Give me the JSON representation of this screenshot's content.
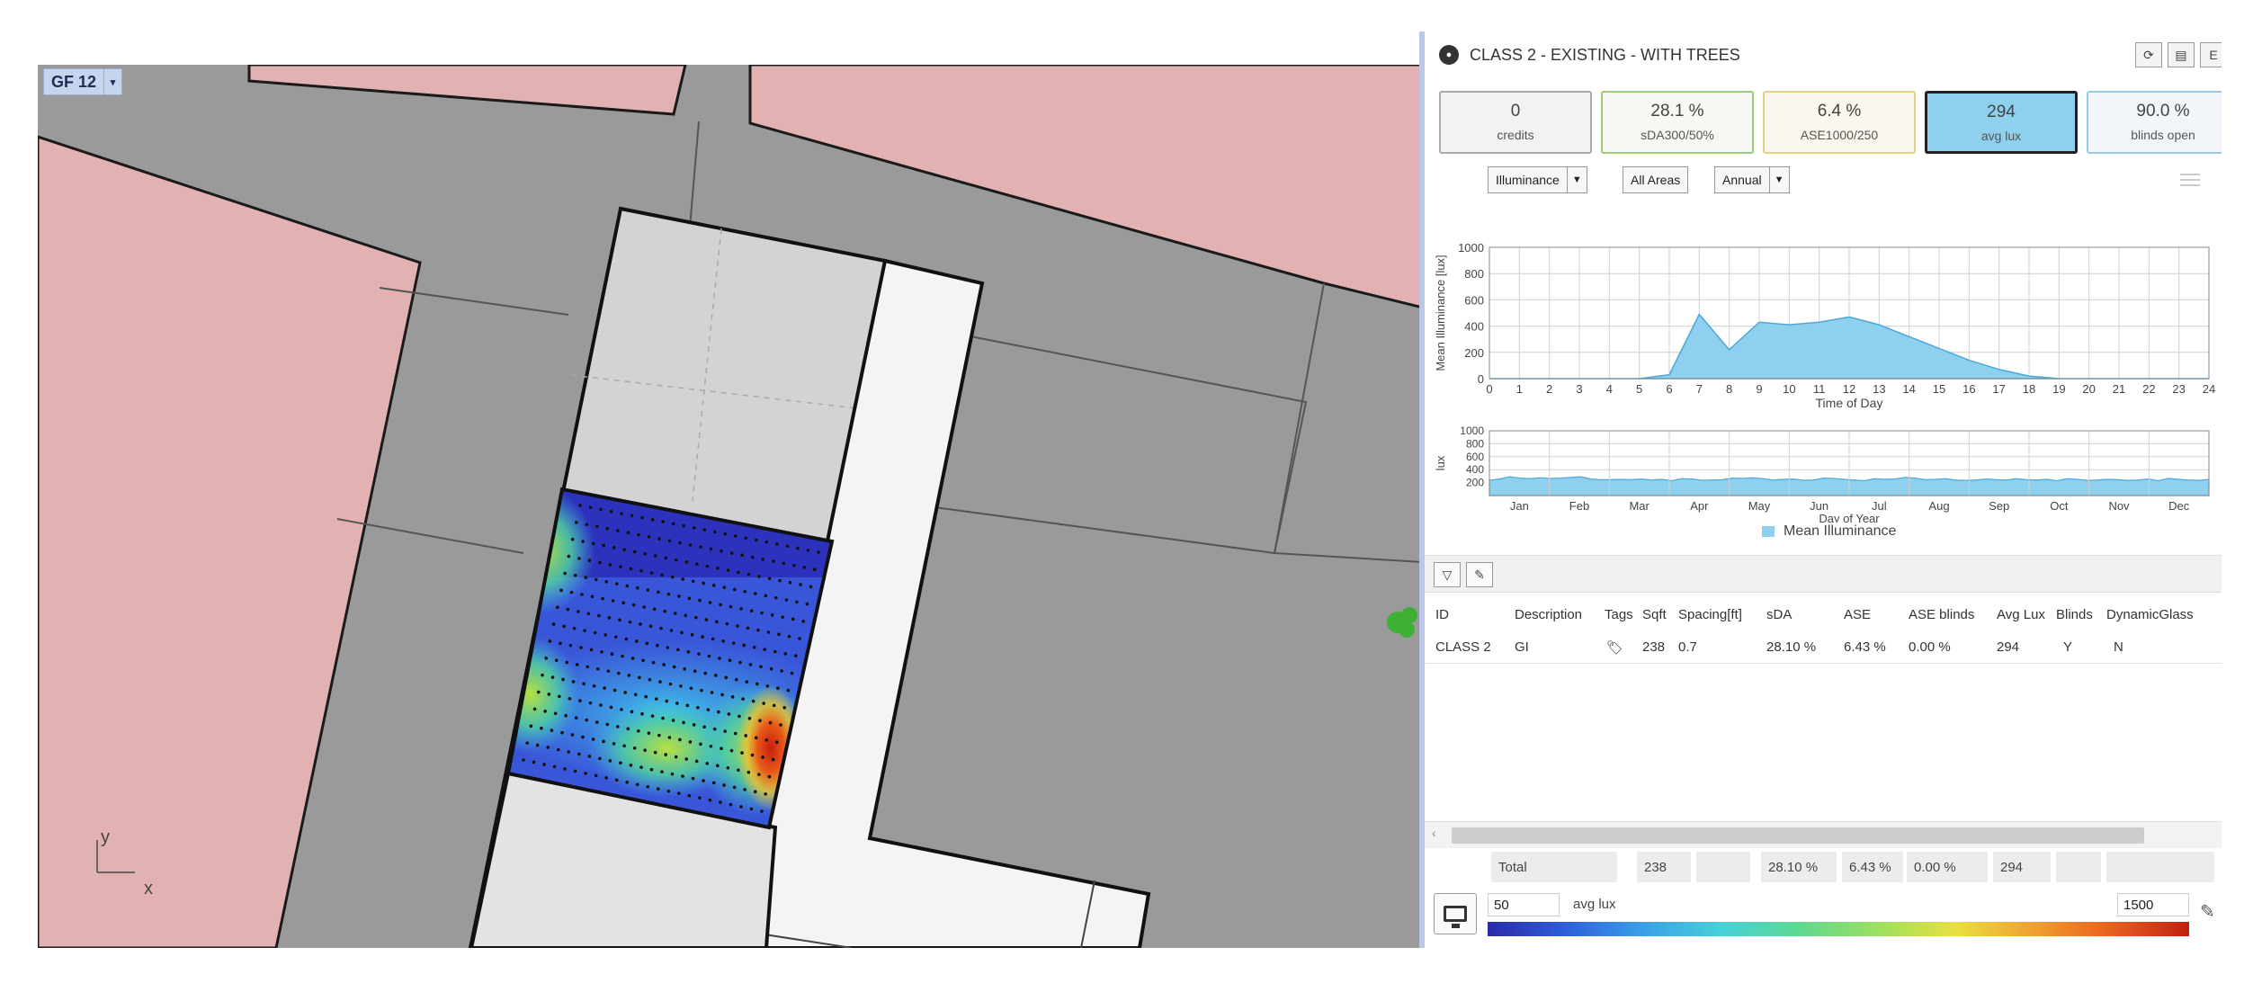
{
  "viewport": {
    "view_tag": "GF 12",
    "view_tag_dropdown": "▾",
    "axis_y_label": "y",
    "axis_x_label": "x",
    "grid_point_rows": 16,
    "grid_point_cols": 24,
    "colors": {
      "pink": "#e2b2b2",
      "road": "#9a9a9a",
      "room": "#d3d3d3",
      "corridor": "#f4f4f4",
      "tree": "#3db033"
    }
  },
  "panel": {
    "title": "CLASS 2 - EXISTING - WITH TREES",
    "toolbar_icons": [
      "refresh-icon",
      "save-icon",
      "export-icon"
    ],
    "metrics": [
      {
        "value": "0",
        "caption": "credits",
        "border": "#aaaaaa",
        "fill": "#f2f2f2"
      },
      {
        "value": "28.1 %",
        "caption": "sDA300/50%",
        "border": "#9ccc7a",
        "fill": "#f6f9f3"
      },
      {
        "value": "6.4 %",
        "caption": "ASE1000/250",
        "border": "#e6d080",
        "fill": "#f9f7ee"
      },
      {
        "value": "294",
        "caption": "avg lux",
        "border": "#222222",
        "fill": "#8fd0ee"
      },
      {
        "value": "90.0 %",
        "caption": "blinds open",
        "border": "#9cc8e8",
        "fill": "#f2f6fb"
      }
    ],
    "selects": {
      "metric": "Illuminance",
      "area": "All Areas",
      "period": "Annual"
    },
    "legend_label": "Mean Illuminance",
    "table": {
      "headers": [
        "ID",
        "Description",
        "Tags",
        "Sqft",
        "Spacing[ft]",
        "sDA",
        "ASE",
        "ASE blinds",
        "Avg Lux",
        "Blinds",
        "DynamicGlass"
      ],
      "rows": [
        {
          "ID": "CLASS 2",
          "Description": "GI",
          "Tags": "",
          "Sqft": "238",
          "Spacing": "0.7",
          "sDA": "28.10 %",
          "ASE": "6.43 %",
          "ASE_blinds": "0.00 %",
          "Avg_Lux": "294",
          "Blinds": "Y",
          "DynamicGlass": "N"
        }
      ],
      "totals": {
        "label": "Total",
        "Sqft": "238",
        "sDA": "28.10 %",
        "ASE": "6.43 %",
        "ASE_blinds": "0.00 %",
        "Avg_Lux": "294"
      }
    },
    "colorbar": {
      "min": "50",
      "label": "avg lux",
      "max": "1500"
    }
  },
  "chart_data": [
    {
      "type": "area",
      "ylabel": "Mean Illuminance [lux]",
      "xlabel": "Time of Day",
      "ylim": [
        0,
        1000
      ],
      "yticks": [
        "0",
        "200",
        "400",
        "600",
        "800",
        "1000"
      ],
      "x": [
        0,
        1,
        2,
        3,
        4,
        5,
        6,
        7,
        8,
        9,
        10,
        11,
        12,
        13,
        14,
        15,
        16,
        17,
        18,
        19,
        20,
        21,
        22,
        23,
        24
      ],
      "values": [
        0,
        0,
        0,
        0,
        0,
        0,
        30,
        490,
        220,
        430,
        410,
        430,
        470,
        410,
        320,
        230,
        140,
        70,
        20,
        0,
        0,
        0,
        0,
        0,
        0
      ],
      "series": [
        {
          "name": "Mean Illuminance"
        }
      ],
      "grid": true
    },
    {
      "type": "area",
      "ylabel": "lux",
      "xlabel": "Day of Year",
      "ylim": [
        0,
        1000
      ],
      "yticks": [
        "200",
        "400",
        "600",
        "800",
        "1000"
      ],
      "categories": [
        "Jan",
        "Feb",
        "Mar",
        "Apr",
        "May",
        "Jun",
        "Jul",
        "Aug",
        "Sep",
        "Oct",
        "Nov",
        "Dec"
      ],
      "values": [
        235,
        255,
        290,
        270,
        260,
        275,
        265,
        270,
        280,
        290,
        255,
        245,
        245,
        250,
        245,
        255,
        240,
        250,
        230,
        260,
        255,
        235,
        240,
        245,
        270,
        265,
        275,
        260,
        240,
        250,
        255,
        235,
        240,
        270,
        265,
        250,
        240,
        230,
        260,
        250,
        255,
        280,
        270,
        245,
        250,
        260,
        240,
        235,
        240,
        255,
        245,
        240,
        260,
        245,
        240,
        250,
        230,
        260,
        250,
        235,
        240,
        250,
        245,
        235,
        240,
        255,
        230,
        265,
        250,
        240,
        235,
        250
      ],
      "grid": true
    }
  ]
}
